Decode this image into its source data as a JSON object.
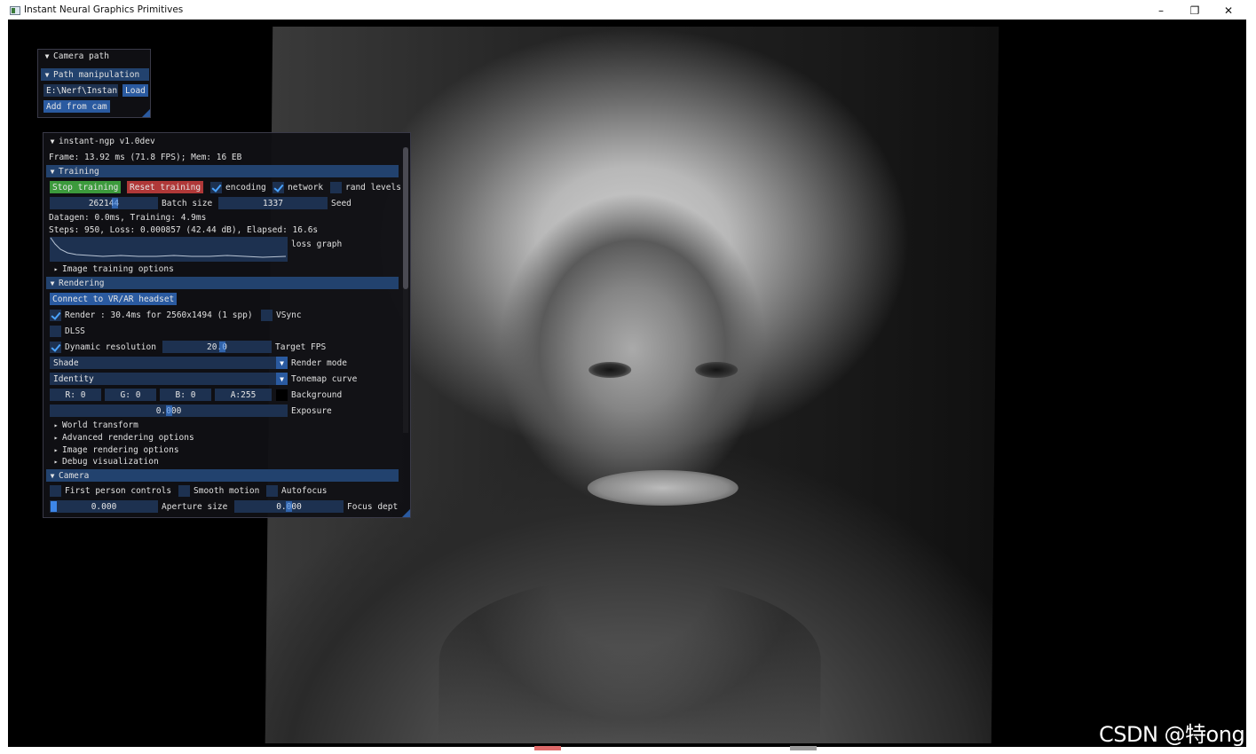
{
  "window": {
    "title": "Instant Neural Graphics Primitives",
    "minimize": "–",
    "restore": "❐",
    "close": "✕"
  },
  "camera_path_panel": {
    "title": "Camera path",
    "subheader": "Path manipulation",
    "path_value": "E:\\Nerf\\Instan",
    "load_label": "Load",
    "add_from_cam_label": "Add from cam"
  },
  "main_panel": {
    "title": "instant-ngp v1.0dev",
    "frame_stats": "Frame: 13.92 ms (71.8 FPS); Mem: 16 EB",
    "training": {
      "header": "Training",
      "stop_label": "Stop training",
      "reset_label": "Reset training",
      "encoding_label": "encoding",
      "encoding_checked": true,
      "network_label": "network",
      "network_checked": true,
      "rand_levels_label": "rand levels",
      "rand_levels_checked": false,
      "batch_size_value": "262144",
      "batch_size_label": "Batch size",
      "seed_value": "1337",
      "seed_label": "Seed",
      "timing": "Datagen: 0.0ms, Training: 4.9ms",
      "steps": "Steps: 950, Loss: 0.000857 (42.44 dB), Elapsed: 16.6s",
      "loss_graph_label": "loss graph",
      "image_training_options": "Image training options"
    },
    "rendering": {
      "header": "Rendering",
      "vr_label": "Connect to VR/AR headset",
      "render_label": "Render : 30.4ms for 2560x1494 (1 spp)",
      "render_checked": true,
      "vsync_label": "VSync",
      "vsync_checked": false,
      "dlss_label": "DLSS",
      "dlss_checked": false,
      "dynamic_res_label": "Dynamic resolution",
      "dynamic_res_checked": true,
      "target_fps_value": "20.0",
      "target_fps_label": "Target FPS",
      "render_mode_value": "Shade",
      "render_mode_label": "Render mode",
      "tonemap_value": "Identity",
      "tonemap_label": "Tonemap curve",
      "bg_r": "R:  0",
      "bg_g": "G:  0",
      "bg_b": "B:  0",
      "bg_a": "A:255",
      "background_label": "Background",
      "exposure_value": "0.000",
      "exposure_label": "Exposure",
      "world_transform": "World transform",
      "advanced_rendering": "Advanced rendering options",
      "image_rendering": "Image rendering options",
      "debug_visualization": "Debug visualization"
    },
    "camera": {
      "header": "Camera",
      "first_person_label": "First person controls",
      "smooth_motion_label": "Smooth motion",
      "autofocus_label": "Autofocus",
      "aperture_value": "0.000",
      "aperture_label": "Aperture size",
      "focus_value": "0.000",
      "focus_label": "Focus dept"
    }
  },
  "watermark": "CSDN @特ong",
  "colors": {
    "header_bg": "#22426e",
    "button_blue": "#2a5aa0",
    "stop_green": "#3c9a3c",
    "reset_red": "#b03838",
    "field_bg": "#1d3150"
  }
}
